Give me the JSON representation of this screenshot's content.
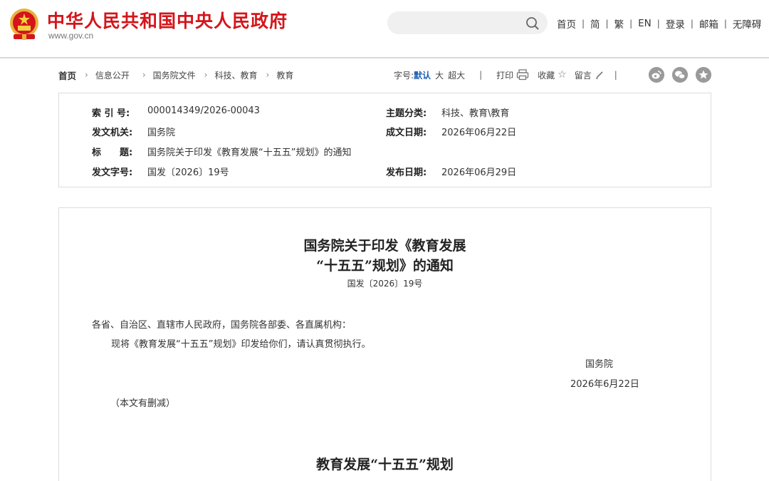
{
  "header": {
    "site_title": "中华人民共和国中央人民政府",
    "site_url": "www.gov.cn",
    "search": {
      "placeholder": "",
      "icon": "search-icon"
    },
    "nav": [
      "首页",
      "简",
      "繁",
      "EN",
      "登录",
      "邮箱",
      "无障碍"
    ],
    "brand_color": "#d4151b"
  },
  "breadcrumb": {
    "items": [
      "首页",
      "信息公开",
      "国务院文件",
      "科技、教育",
      "教育"
    ]
  },
  "tools": {
    "font_label": "字号:",
    "font_default": "默认",
    "font_large": "大",
    "font_xlarge": "超大",
    "print": "打印",
    "favorite": "收藏",
    "comment": "留言",
    "share_icons": [
      "weibo-icon",
      "wechat-icon",
      "favorite-star-icon"
    ]
  },
  "info": {
    "index_label": "索 引 号:",
    "index_value": "000014349/2026-00043",
    "category_label": "主题分类:",
    "category_value": "科技、教育\\教育",
    "issuer_label": "发文机关:",
    "issuer_value": "国务院",
    "date_written_label": "成文日期:",
    "date_written_value": "2026年06月22日",
    "title_label": "标　　题:",
    "title_value": "国务院关于印发《教育发展“十五五”规划》的通知",
    "doc_number_label": "发文字号:",
    "doc_number_value": "国发〔2026〕19号",
    "publish_date_label": "发布日期:",
    "publish_date_value": "2026年06月29日"
  },
  "document": {
    "title_line1": "国务院关于印发《教育发展",
    "title_line2": "“十五五”规划》的通知",
    "doc_number": "国发〔2026〕19号",
    "addressee": "各省、自治区、直辖市人民政府，国务院各部委、各直属机构：",
    "body": "现将《教育发展“十五五”规划》印发给你们，请认真贯彻执行。",
    "signer": "国务院",
    "sign_date": "2026年6月22日",
    "note": "（本文有删减）",
    "section_title": "教育发展“十五五”规划"
  }
}
